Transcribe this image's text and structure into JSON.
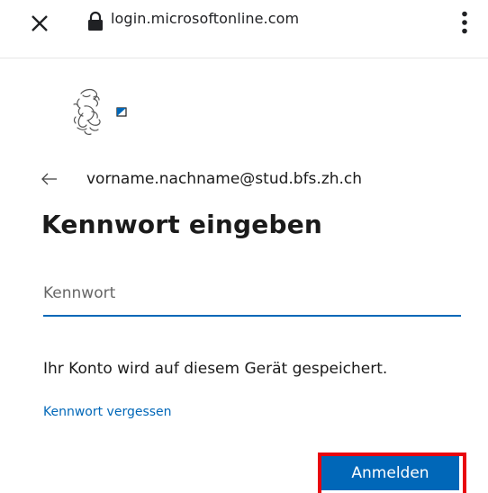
{
  "browser": {
    "url": "login.microsoftonline.com",
    "close_icon": "close-icon",
    "lock_icon": "lock-icon",
    "menu_icon": "more-vert-icon"
  },
  "signin": {
    "logo_icon": "zurich-lion-logo",
    "back_icon": "back-arrow-icon",
    "email": "vorname.nachname@stud.bfs.zh.ch",
    "title": "Kennwort eingeben",
    "password_placeholder": "Kennwort",
    "password_value": "",
    "saved_note": "Ihr Konto wird auf diesem Gerät gespeichert.",
    "forgot_link": "Kennwort vergessen",
    "submit_label": "Anmelden"
  },
  "colors": {
    "accent": "#0067b8",
    "highlight": "#e8060f"
  }
}
